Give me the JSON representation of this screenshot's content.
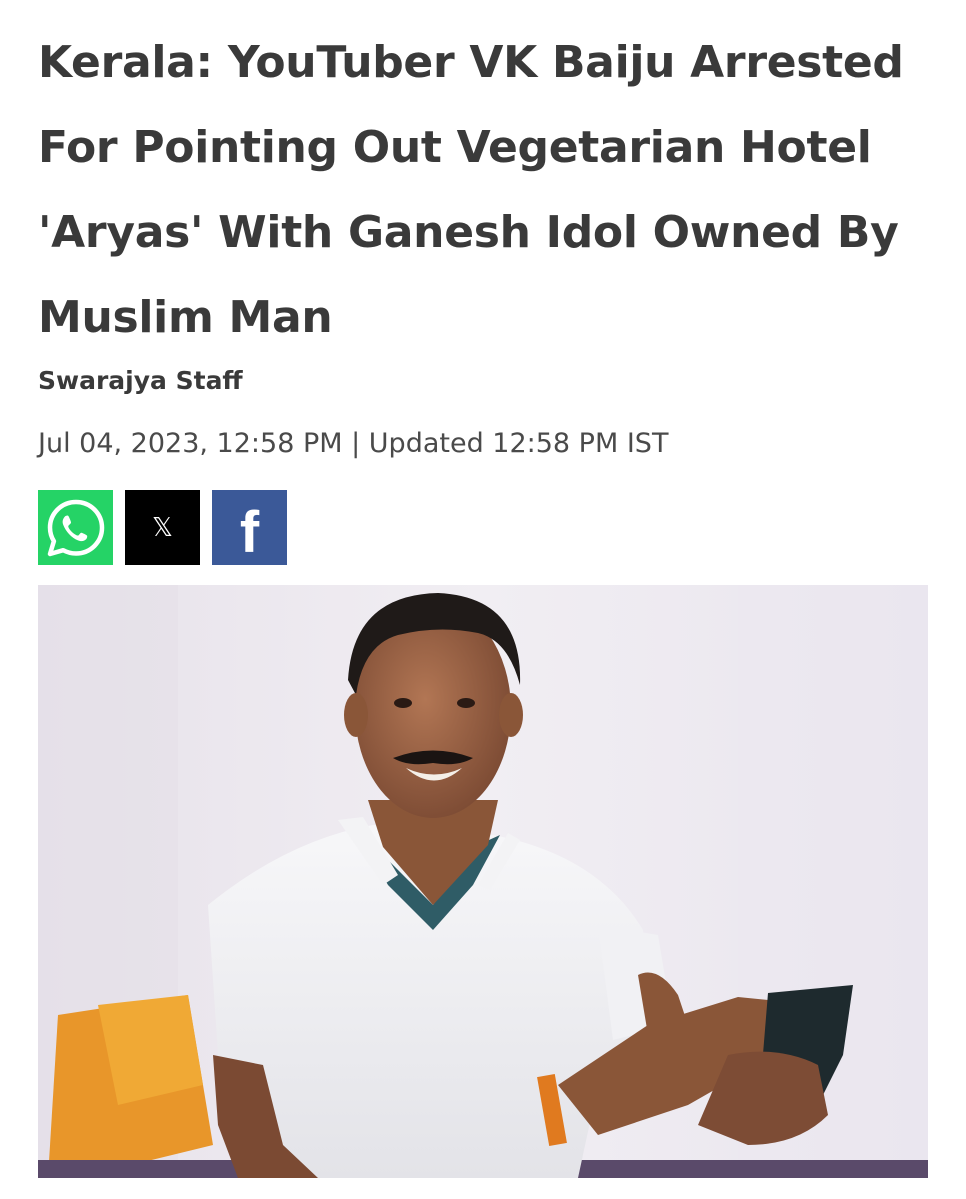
{
  "article": {
    "headline_lines": [
      "Kerala: YouTuber VK Baiju Arrested",
      "For Pointing Out Vegetarian Hotel",
      "'Aryas' With Ganesh Idol Owned By",
      "Muslim Man"
    ],
    "author": "Swarajya Staff",
    "dateline": "Jul 04, 2023, 12:58 PM | Updated 12:58 PM IST"
  },
  "share": {
    "whatsapp_icon": "whatsapp-icon",
    "x_icon": "x-icon",
    "x_glyph": "𝕏",
    "facebook_icon": "facebook-icon",
    "facebook_glyph": "f",
    "colors": {
      "whatsapp": "#25d366",
      "x": "#000000",
      "facebook": "#3b5998"
    }
  },
  "photo": {
    "subject": "man-holding-phone-photo"
  }
}
